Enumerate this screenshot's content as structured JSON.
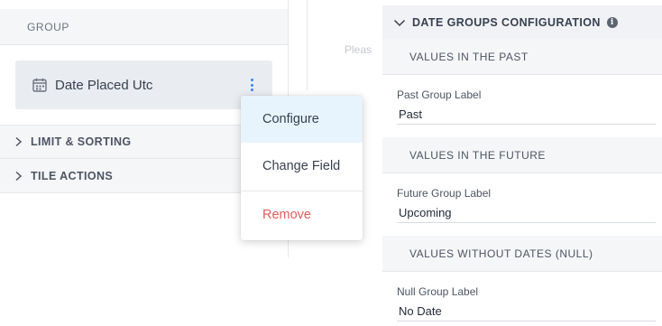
{
  "left_panel": {
    "group_header": "GROUP",
    "field_chip": {
      "label": "Date Placed Utc",
      "icon": "calendar-icon"
    },
    "sections": [
      {
        "label": "LIMIT & SORTING"
      },
      {
        "label": "TILE ACTIONS"
      }
    ],
    "placeholder": "Pleas"
  },
  "context_menu": {
    "items": [
      {
        "label": "Configure",
        "highlighted": true
      },
      {
        "label": "Change Field"
      },
      {
        "label": "Remove",
        "color": "#e25c5c"
      }
    ]
  },
  "right_panel": {
    "title": "DATE GROUPS CONFIGURATION",
    "past": {
      "heading": "VALUES IN THE PAST",
      "field_label": "Past Group Label",
      "value": "Past"
    },
    "future": {
      "heading": "VALUES IN THE FUTURE",
      "field_label": "Future Group Label",
      "value": "Upcoming"
    },
    "null": {
      "heading": "VALUES WITHOUT DATES (NULL)",
      "field_label": "Null Group Label",
      "value": "No Date"
    }
  },
  "colors": {
    "accent": "#3b82f6",
    "menu_highlight": "#e8f4fd",
    "danger": "#e25c5c"
  }
}
